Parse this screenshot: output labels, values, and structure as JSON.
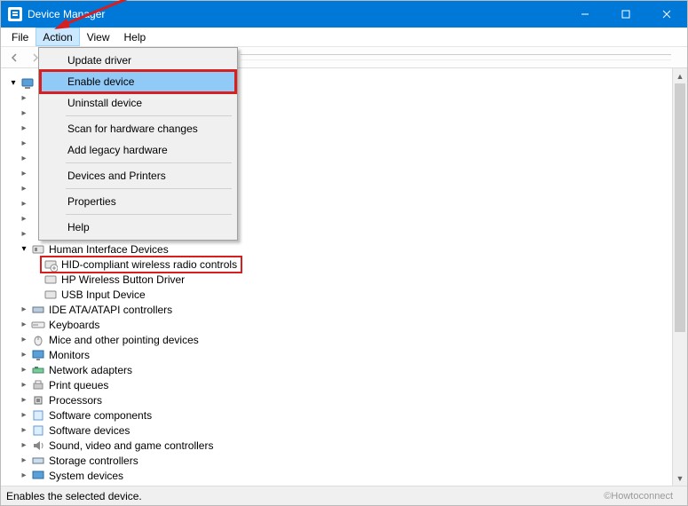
{
  "window": {
    "title": "Device Manager"
  },
  "menubar": {
    "file": "File",
    "action": "Action",
    "view": "View",
    "help": "Help"
  },
  "action_menu": {
    "update_driver": "Update driver",
    "enable_device": "Enable device",
    "uninstall_device": "Uninstall device",
    "scan_hw": "Scan for hardware changes",
    "add_legacy": "Add legacy hardware",
    "devices_printers": "Devices and Printers",
    "properties": "Properties",
    "help": "Help"
  },
  "tree": {
    "hid_category": "Human Interface Devices",
    "hid_wireless": "HID-compliant wireless radio controls",
    "hp_wireless": "HP Wireless Button Driver",
    "usb_input": "USB Input Device",
    "ide": "IDE ATA/ATAPI controllers",
    "keyboards": "Keyboards",
    "mice": "Mice and other pointing devices",
    "monitors": "Monitors",
    "network": "Network adapters",
    "printq": "Print queues",
    "processors": "Processors",
    "softcomp": "Software components",
    "softdev": "Software devices",
    "sound": "Sound, video and game controllers",
    "storage": "Storage controllers",
    "sysdev": "System devices"
  },
  "status": {
    "text": "Enables the selected device.",
    "watermark": "©Howtoconnect"
  }
}
